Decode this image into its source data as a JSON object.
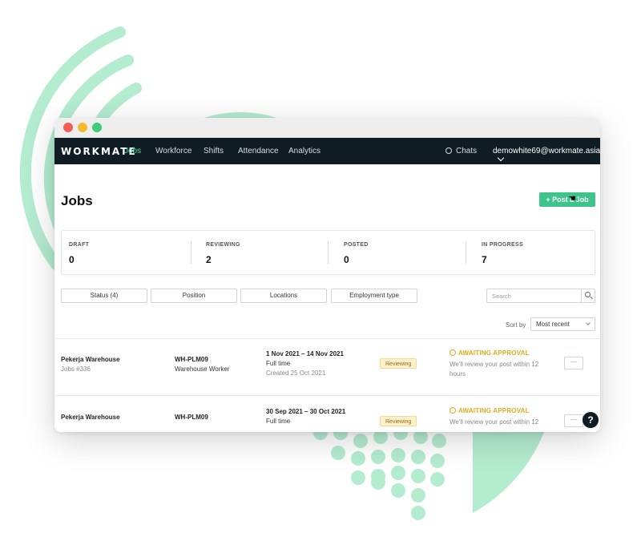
{
  "app": {
    "logo": "WORKMATE",
    "nav": [
      "Jobs",
      "Workforce",
      "Shifts",
      "Attendance",
      "Analytics"
    ],
    "chats": "Chats",
    "account": "demowhite69@workmate.asia"
  },
  "page": {
    "title": "Jobs",
    "post_button": "+  Post a Job"
  },
  "stats": [
    {
      "label": "DRAFT",
      "value": "0"
    },
    {
      "label": "REVIEWING",
      "value": "2"
    },
    {
      "label": "POSTED",
      "value": "0"
    },
    {
      "label": "IN PROGRESS",
      "value": "7"
    }
  ],
  "filters": {
    "status": "Status (4)",
    "position": "Position",
    "locations": "Locations",
    "employment": "Employment type",
    "search_placeholder": "Search"
  },
  "sort": {
    "label": "Sort by",
    "value": "Most recent"
  },
  "jobs": [
    {
      "location": "Pekerja Warehouse",
      "job_number": "Jobs #336",
      "code": "WH-PLM09",
      "position": "Warehouse Worker",
      "dates": "1 Nov 2021 – 14 Nov 2021",
      "employment": "Full time",
      "created": "Created 25 Oct 2021",
      "status": "Reviewing",
      "approval": "AWAITING APPROVAL",
      "note": "We'll review your post within 12 hours",
      "more": "···"
    },
    {
      "location": "Pekerja Warehouse",
      "code": "WH-PLM09",
      "dates": "30 Sep 2021 – 30 Oct 2021",
      "employment": "Full time",
      "status": "Reviewing",
      "approval": "AWAITING APPROVAL",
      "note": "We'll review your post within 12",
      "more": "···"
    }
  ],
  "help": "?",
  "colors": {
    "accent": "#3dc48c",
    "nav_bg": "#0f1c24",
    "warning": "#e6a817",
    "deco": "#b4ecd0"
  }
}
